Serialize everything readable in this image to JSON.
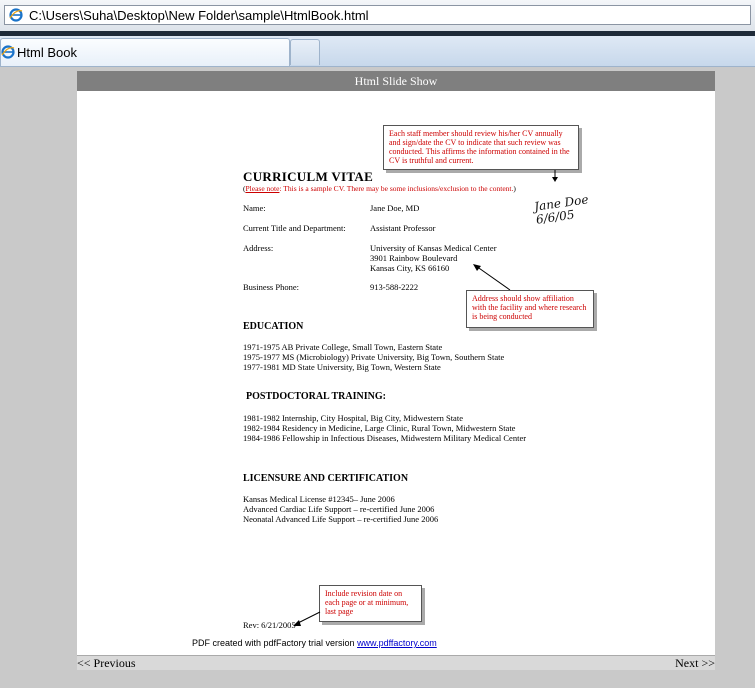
{
  "browser": {
    "address": "C:\\Users\\Suha\\Desktop\\New Folder\\sample\\HtmlBook.html",
    "tab_title": "Html Book"
  },
  "slideshow": {
    "header": "Html Slide Show",
    "prev_label": "<< Previous",
    "next_label": "Next >>"
  },
  "cv": {
    "title": "CURRICULM VITAE",
    "note_open": "(",
    "note_label": "Please note",
    "note_text": ": This is a sample CV.  There may be some inclusions/exclusion to the content.",
    "note_close": ")",
    "fields": [
      {
        "label": "Name:",
        "value": "Jane Doe, MD"
      },
      {
        "label": "Current Title and Department:",
        "value": "Assistant Professor"
      },
      {
        "label": "Address:",
        "value": "University of Kansas Medical Center"
      },
      {
        "label": "Business Phone:",
        "value": "913-588-2222"
      }
    ],
    "address_lines": [
      "3901 Rainbow Boulevard",
      "Kansas City, KS 66160"
    ],
    "signature": [
      "Jane Doe",
      "6/6/05"
    ],
    "education_title": "EDUCATION",
    "education": [
      "1971-1975 AB Private College, Small Town, Eastern State",
      "1975-1977 MS (Microbiology) Private University, Big Town, Southern State",
      "1977-1981 MD State University, Big Town, Western State"
    ],
    "postdoc_title": "POSTDOCTORAL TRAINING:",
    "postdoc": [
      "1981-1982 Internship, City Hospital, Big City, Midwestern State",
      "1982-1984 Residency in Medicine, Large Clinic, Rural Town, Midwestern State",
      "1984-1986 Fellowship in Infectious Diseases, Midwestern Military Medical Center"
    ],
    "license_title": "LICENSURE AND CERTIFICATION",
    "license": [
      "Kansas Medical License #12345– June 2006",
      "Advanced Cardiac Life Support – re-certified June 2006",
      "Neonatal Advanced Life Support – re-certified June 2006"
    ],
    "revision": "Rev: 6/21/2005",
    "callout_top": "Each staff member should review his/her CV annually and sign/date the CV to indicate that such review was conducted. This affirms the information contained in the CV is truthful and current.",
    "callout_address": "Address should show affiliation with the facility and where research is being conducted",
    "callout_revision": "Include revision date on each page or at minimum, last page",
    "pdf_prefix": "PDF created with pdfFactory trial version ",
    "pdf_link": "www.pdffactory.com"
  },
  "colors": {
    "annotation": "#cc0000",
    "header_bar": "#7f7f7f",
    "link": "#0000cc"
  },
  "icons": [
    "ie-icon"
  ]
}
